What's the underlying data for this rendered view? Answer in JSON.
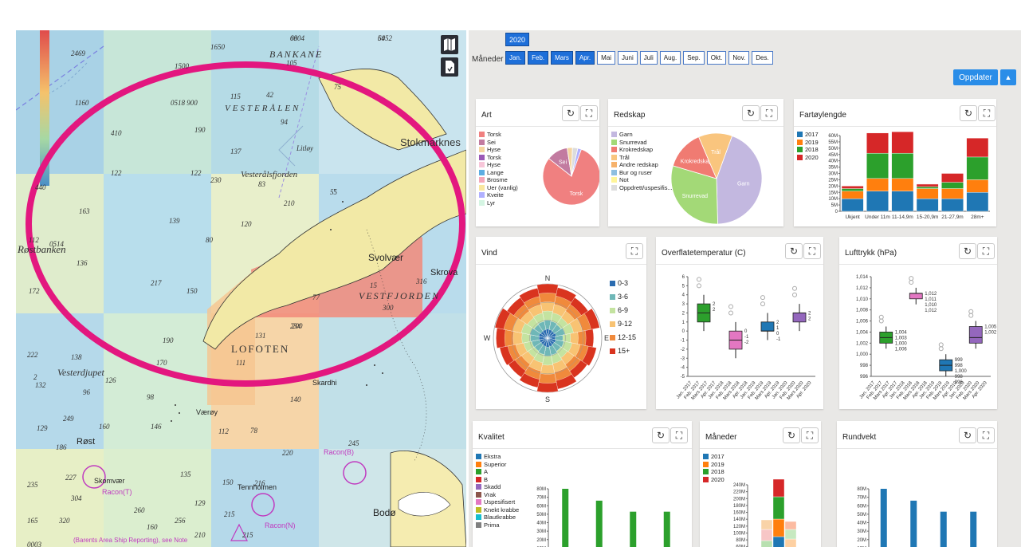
{
  "map": {
    "labels": {
      "bankane": "BANKANE",
      "vesteralen": "VESTERÅLEN",
      "vesteralsfjorden": "Vesterålsfjorden",
      "stokmarknes": "Stokmarknes",
      "litloy": "Litløy",
      "rostbanken": "Røstbanken",
      "lofoten": "LOFOTEN",
      "vestfjorden": "VESTFJORDEN",
      "svolvaer": "Svolvær",
      "skrova": "Skrova",
      "vesterdjupet": "Vesterdjupet",
      "rost": "Røst",
      "vaeroy": "Værøy",
      "skomvaer": "Skomvær",
      "tennholmen": "Tennholmen",
      "bodo": "Bodø",
      "racon_t": "Racon(T)",
      "racon_b": "Racon(B)",
      "racon_n": "Racon(N)",
      "karl": "Skardhi",
      "note": "(Barents Area Ship Reporting), see Note"
    },
    "depths": [
      "68",
      "64",
      "1650",
      "2469",
      "1500",
      "105",
      "115",
      "42",
      "75",
      "1160",
      "0518 900",
      "94",
      "410",
      "190",
      "137",
      "122",
      "122",
      "230",
      "83",
      "440",
      "163",
      "139",
      "210",
      "120",
      "55",
      "112",
      "0514",
      "80",
      "136",
      "172",
      "217",
      "150",
      "77",
      "15",
      "316",
      "300",
      "131",
      "234",
      "190",
      "200",
      "170",
      "111",
      "222",
      "138",
      "2",
      "132",
      "126",
      "96",
      "98",
      "140",
      "249",
      "160",
      "129",
      "186",
      "146",
      "112",
      "78",
      "245",
      "220",
      "227",
      "304",
      "135",
      "150",
      "216",
      "235",
      "260",
      "129",
      "215",
      "215",
      "165",
      "320",
      "160",
      "0003",
      "256",
      "210",
      "0004",
      "5052"
    ]
  },
  "tools": {
    "map_icon": "map-icon",
    "doc_icon": "document-icon"
  },
  "filters": {
    "year": "2020",
    "months_label": "Måneder :",
    "months": [
      "Jan.",
      "Feb.",
      "Mars",
      "Apr.",
      "Mai",
      "Juni",
      "Juli",
      "Aug.",
      "Sep.",
      "Okt.",
      "Nov.",
      "Des."
    ],
    "active_months": [
      0,
      1,
      2,
      3
    ],
    "update_label": "Oppdater",
    "update_arrow": "▲"
  },
  "cards": {
    "art": {
      "title": "Art"
    },
    "redskap": {
      "title": "Redskap"
    },
    "fartoy": {
      "title": "Fartøylengde"
    },
    "vind": {
      "title": "Vind"
    },
    "temp": {
      "title": "Overflatetemperatur (C)"
    },
    "trykk": {
      "title": "Lufttrykk (hPa)"
    },
    "kvalitet": {
      "title": "Kvalitet"
    },
    "maneder": {
      "title": "Måneder"
    },
    "rundvekt": {
      "title": "Rundvekt"
    }
  },
  "icons": {
    "refresh": "↻",
    "expand": "⛶"
  },
  "colors": {
    "accent": "#1e6fd9",
    "year2017": "#1f77b4",
    "year2018": "#2ca02c",
    "year2019": "#ff7f0e",
    "year2020": "#d62728"
  },
  "chart_data": [
    {
      "id": "art",
      "type": "pie",
      "legend": [
        "Torsk",
        "Sei",
        "Hyse",
        "Torsk",
        "Hyse",
        "Lange",
        "Brosme",
        "Uer (vanlig)",
        "Kveite",
        "Lyr"
      ],
      "legend_colors": [
        "#f08080",
        "#c27ba0",
        "#f5d5a0",
        "#9b59b6",
        "#f7c6d9",
        "#5dade2",
        "#f4a7b9",
        "#f9e79f",
        "#b0b0ff",
        "#d5f5e3"
      ],
      "slices": [
        {
          "label": "Torsk",
          "value": 80,
          "color": "#f08080"
        },
        {
          "label": "Sei",
          "value": 12,
          "color": "#c27ba0"
        },
        {
          "label": "",
          "value": 3,
          "color": "#f5d5a0"
        },
        {
          "label": "",
          "value": 3,
          "color": "#dcdcdc"
        },
        {
          "label": "",
          "value": 2,
          "color": "#b0b0ff"
        }
      ]
    },
    {
      "id": "redskap",
      "type": "pie",
      "legend": [
        "Garn",
        "Snurrevad",
        "Krokredskap",
        "Trål",
        "Andre redskap",
        "Bur og ruser",
        "Not",
        "Oppdrett/uspesifis..."
      ],
      "legend_colors": [
        "#c3b8e0",
        "#a3d977",
        "#f07b72",
        "#f9c57e",
        "#f6b26b",
        "#8fbfe0",
        "#fff599",
        "#dddddd"
      ],
      "slices": [
        {
          "label": "Garn",
          "value": 44,
          "color": "#c3b8e0"
        },
        {
          "label": "Snurrevad",
          "value": 30,
          "color": "#a3d977"
        },
        {
          "label": "Krokredskap",
          "value": 14,
          "color": "#f07b72"
        },
        {
          "label": "Trål",
          "value": 12,
          "color": "#f9c57e"
        }
      ]
    },
    {
      "id": "fartoy",
      "type": "bar",
      "stacked": true,
      "legend": [
        "2017",
        "2019",
        "2018",
        "2020"
      ],
      "categories": [
        "Ukjent",
        "Under 11m",
        "11-14,9m",
        "15-20,9m",
        "21-27,9m",
        "28m+"
      ],
      "yticks": [
        "0",
        "5M",
        "10M",
        "15M",
        "20M",
        "25M",
        "30M",
        "35M",
        "40M",
        "45M",
        "50M",
        "55M",
        "60M"
      ],
      "ylim": [
        0,
        60000000
      ],
      "series": [
        {
          "name": "2017",
          "values": [
            10000000,
            16000000,
            16000000,
            10000000,
            10000000,
            15000000
          ]
        },
        {
          "name": "2019",
          "values": [
            6000000,
            10000000,
            10000000,
            8000000,
            8000000,
            10000000
          ]
        },
        {
          "name": "2018",
          "values": [
            2000000,
            20000000,
            20000000,
            1500000,
            5000000,
            18000000
          ]
        },
        {
          "name": "2020",
          "values": [
            2000000,
            16000000,
            17000000,
            2000000,
            7000000,
            15000000
          ]
        }
      ]
    },
    {
      "id": "vind",
      "type": "other",
      "directions": [
        "N",
        "E",
        "S",
        "W"
      ],
      "legend": [
        "0-3",
        "3-6",
        "6-9",
        "9-12",
        "12-15",
        "15+"
      ],
      "legend_colors": [
        "#2b6cb0",
        "#6fb7b7",
        "#c4e3a0",
        "#f8c373",
        "#f08a3c",
        "#d9341f"
      ]
    },
    {
      "id": "temp",
      "type": "other",
      "yticks": [
        "6",
        "5",
        "4",
        "3",
        "2",
        "1",
        "0",
        "-1",
        "-2",
        "-3",
        "-4",
        "-5"
      ],
      "xticks": [
        "Jan. 2017",
        "Feb. 2017",
        "Mars 2017",
        "Apr. 2017",
        "Jan. 2018",
        "Feb. 2018",
        "Mars 2018",
        "Apr. 2018",
        "Jan. 2019",
        "Feb. 2019",
        "Mars 2019",
        "Apr. 2019",
        "Jan. 2020",
        "Feb. 2020",
        "Mars 2020",
        "Apr. 2020"
      ],
      "boxes": [
        {
          "median": 2,
          "q1": 1,
          "q3": 3,
          "color": "#2ca02c",
          "labels": [
            "2",
            "2"
          ]
        },
        {
          "median": -1,
          "q1": -2,
          "q3": 0,
          "color": "#e377c2",
          "labels": [
            "0",
            "-1",
            "-2"
          ]
        },
        {
          "median": 0,
          "q1": 0,
          "q3": 1,
          "color": "#1f77b4",
          "labels": [
            "2",
            "1",
            "0",
            "-1"
          ]
        },
        {
          "median": 2,
          "q1": 1,
          "q3": 2,
          "color": "#9467bd",
          "labels": [
            "2",
            "2"
          ]
        }
      ]
    },
    {
      "id": "trykk",
      "type": "other",
      "yticks": [
        "1,014",
        "1,012",
        "1,010",
        "1,008",
        "1,006",
        "1,004",
        "1,002",
        "1,000",
        "998",
        "996"
      ],
      "xticks": [
        "Jan. 2017",
        "Feb. 2017",
        "Mars 2017",
        "Apr. 2017",
        "Jan. 2018",
        "Feb. 2018",
        "Mars 2018",
        "Apr. 2018",
        "Jan. 2019",
        "Feb. 2019",
        "Mars 2019",
        "Apr. 2019",
        "Jan. 2020",
        "Feb. 2020",
        "Mars 2020",
        "Apr. 2020"
      ],
      "boxes": [
        {
          "median": 1003,
          "q1": 1002,
          "q3": 1004,
          "color": "#2ca02c",
          "labels": [
            "1,004",
            "1,003",
            "1,000",
            "1,006"
          ]
        },
        {
          "median": 1011,
          "q1": 1010,
          "q3": 1011,
          "color": "#e377c2",
          "labels": [
            "1,012",
            "1,011",
            "1,010",
            "1,012"
          ]
        },
        {
          "median": 998,
          "q1": 997,
          "q3": 999,
          "color": "#1f77b4",
          "labels": [
            "999",
            "998",
            "1,000",
            "998",
            "996"
          ]
        },
        {
          "median": 1003,
          "q1": 1002,
          "q3": 1005,
          "color": "#9467bd",
          "labels": [
            "1,005",
            "1,002"
          ]
        }
      ]
    },
    {
      "id": "kvalitet",
      "type": "bar",
      "legend": [
        "Ekstra",
        "Superior",
        "A",
        "B",
        "Skadd",
        "Vrak",
        "Uspesifisert",
        "Knekt krabbe",
        "Blautkrabbe",
        "Prima"
      ],
      "legend_colors": [
        "#1f77b4",
        "#ff7f0e",
        "#2ca02c",
        "#d62728",
        "#9467bd",
        "#8c564b",
        "#e377c2",
        "#bcbd22",
        "#17becf",
        "#7f7f7f"
      ],
      "yticks": [
        "80M",
        "70M",
        "60M",
        "50M",
        "40M",
        "30M",
        "20M",
        "10M"
      ],
      "values": [
        80000000,
        66000000,
        53000000,
        53000000
      ]
    },
    {
      "id": "maneder",
      "type": "bar",
      "stacked": true,
      "legend": [
        "2017",
        "2019",
        "2018",
        "2020"
      ],
      "yticks": [
        "240M",
        "220M",
        "200M",
        "180M",
        "160M",
        "140M",
        "120M",
        "100M",
        "80M",
        "60M",
        "40M"
      ]
    },
    {
      "id": "rundvekt",
      "type": "bar",
      "yticks": [
        "80M",
        "70M",
        "60M",
        "50M",
        "40M",
        "30M",
        "20M",
        "10M"
      ],
      "values": [
        80000000,
        66000000,
        53000000,
        53000000
      ]
    }
  ]
}
